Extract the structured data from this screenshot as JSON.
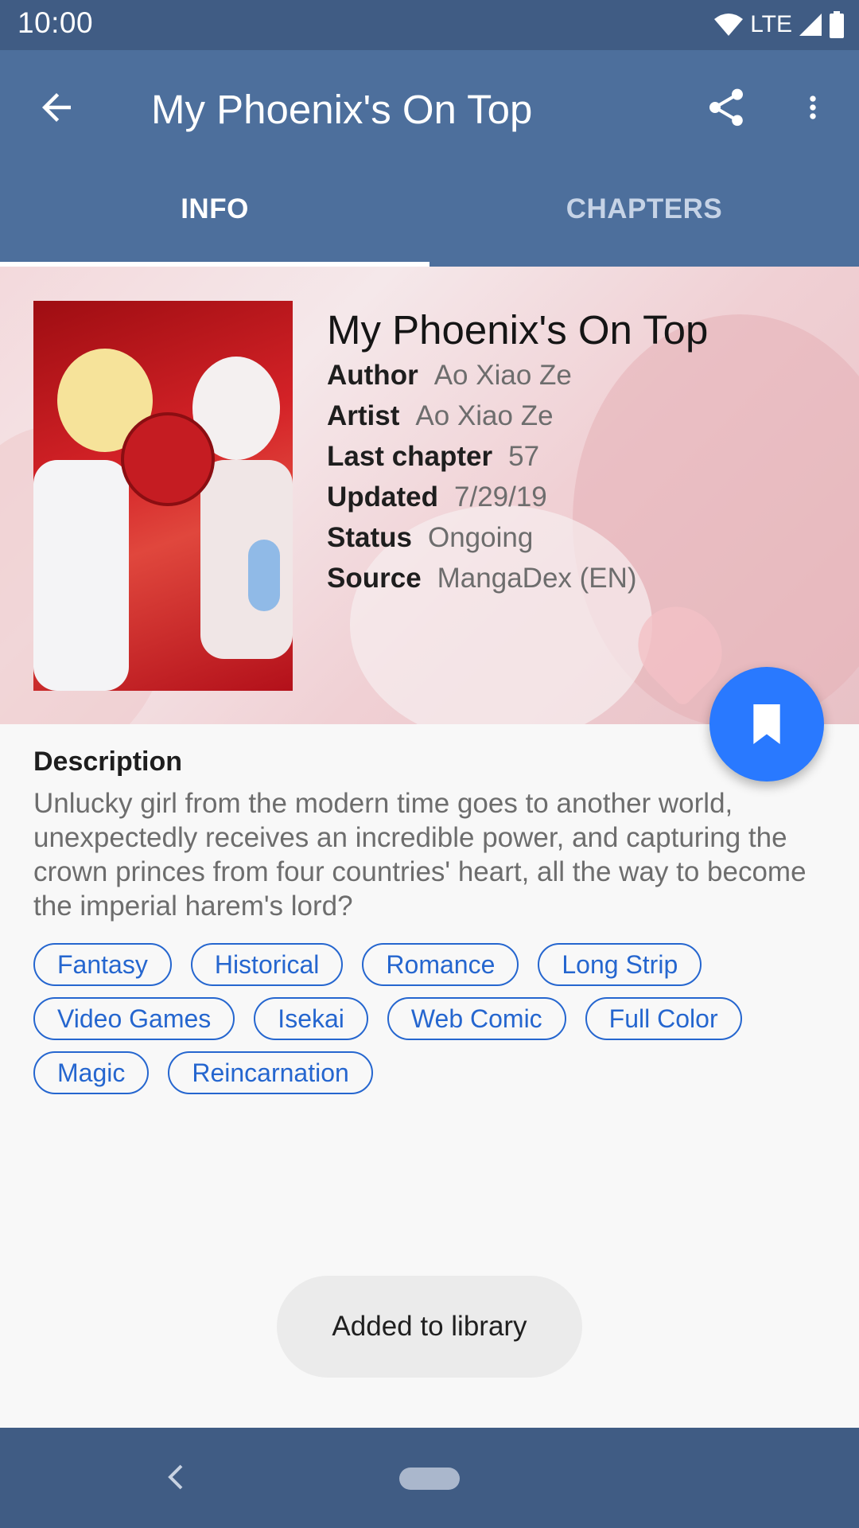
{
  "status_bar": {
    "time": "10:00",
    "network": "LTE"
  },
  "toolbar": {
    "title": "My Phoenix's On Top"
  },
  "tabs": [
    {
      "label": "INFO",
      "active": true
    },
    {
      "label": "CHAPTERS",
      "active": false
    }
  ],
  "manga": {
    "title": "My Phoenix's On Top",
    "details": [
      {
        "label": "Author",
        "value": "Ao Xiao Ze"
      },
      {
        "label": "Artist",
        "value": "Ao Xiao Ze"
      },
      {
        "label": "Last chapter",
        "value": "57"
      },
      {
        "label": "Updated",
        "value": "7/29/19"
      },
      {
        "label": "Status",
        "value": "Ongoing"
      },
      {
        "label": "Source",
        "value": "MangaDex (EN)"
      }
    ]
  },
  "description": {
    "heading": "Description",
    "text": "Unlucky girl from the modern time goes to another world, unexpectedly receives an incredible power, and capturing the crown princes from four countries' heart, all the way to become the imperial harem's lord?"
  },
  "genres": [
    "Fantasy",
    "Historical",
    "Romance",
    "Long Strip",
    "Video Games",
    "Isekai",
    "Web Comic",
    "Full Color",
    "Magic",
    "Reincarnation"
  ],
  "toast": {
    "message": "Added to library"
  },
  "colors": {
    "toolbar": "#4d6f9c",
    "status_bar": "#405c84",
    "accent": "#2979ff",
    "chip": "#2566cf"
  },
  "icons": [
    "back-arrow-icon",
    "share-icon",
    "more-vert-icon",
    "bookmark-icon",
    "wifi-icon",
    "signal-icon",
    "battery-icon"
  ]
}
